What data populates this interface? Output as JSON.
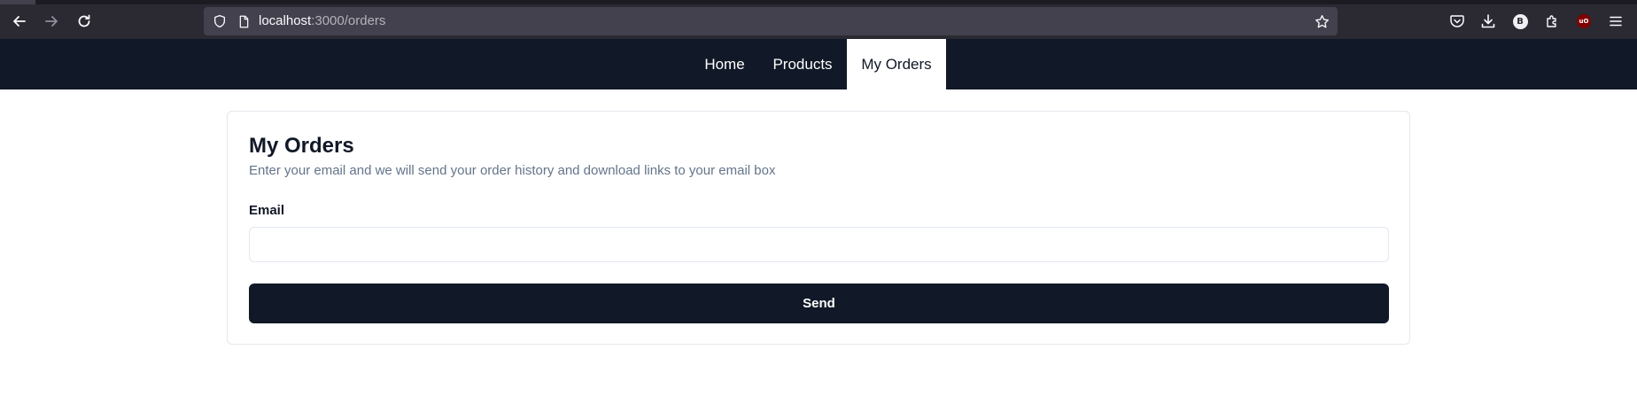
{
  "browser": {
    "url_host": "localhost",
    "url_path": ":3000/orders",
    "icons": [
      "back-icon",
      "forward-icon",
      "reload-icon",
      "shield-icon",
      "page-icon",
      "bookmark-star-icon",
      "pocket-icon",
      "download-icon",
      "extension-b-icon",
      "extensions-icon",
      "ublock-icon",
      "menu-icon"
    ],
    "extension_b_label": "B",
    "ublock_label": "uO"
  },
  "nav": {
    "items": [
      {
        "label": "Home"
      },
      {
        "label": "Products"
      },
      {
        "label": "My Orders",
        "active": true
      }
    ]
  },
  "card": {
    "title": "My Orders",
    "description": "Enter your email and we will send your order history and download links to your email box",
    "email_label": "Email",
    "email_value": "",
    "email_placeholder": "",
    "send_label": "Send"
  },
  "colors": {
    "nav_bg": "#111827",
    "button_bg": "#111827",
    "description_text": "#64748b",
    "browser_bg": "#2b2a33",
    "urlbar_bg": "#42414d"
  }
}
